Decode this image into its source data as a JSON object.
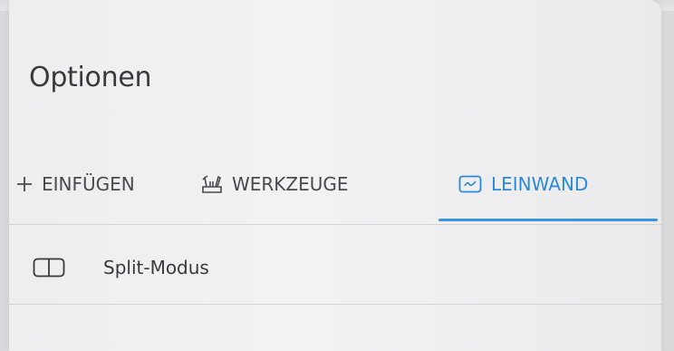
{
  "title": "Optionen",
  "tabs": [
    {
      "label": "EINFÜGEN",
      "icon": "plus-icon",
      "active": false
    },
    {
      "label": "WERKZEUGE",
      "icon": "tools-icon",
      "active": false
    },
    {
      "label": "LEINWAND",
      "icon": "canvas-icon",
      "active": true
    }
  ],
  "rows": [
    {
      "label": "Split-Modus",
      "icon": "split-view-icon"
    }
  ],
  "colors": {
    "accent": "#2b8ad9",
    "text": "#3a3a3c",
    "background": "#f0f0f1"
  }
}
